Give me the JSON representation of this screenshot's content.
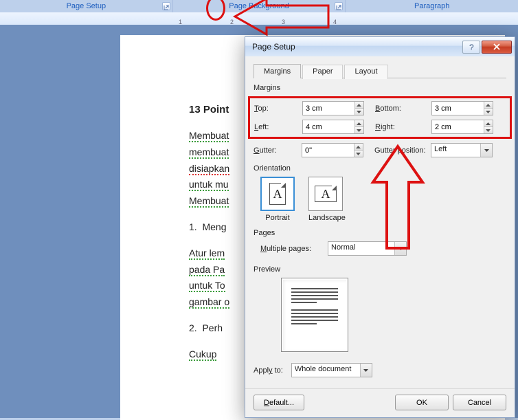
{
  "ribbon": {
    "groups": [
      "Page Setup",
      "Page Background",
      "Paragraph"
    ]
  },
  "ruler": {
    "marks": [
      "1",
      "2",
      "3",
      "4"
    ]
  },
  "document": {
    "title": "13 Point",
    "para1_a": "Membuat",
    "para1_b": "membuat",
    "para1_c": "disiapkan",
    "para1_d": "untuk mu",
    "para1_e": "Membuat",
    "list1": "Meng",
    "para2_a": "Atur lem",
    "para2_b": "pada Pa",
    "para2_c": "untuk To",
    "para2_d": "gambar o",
    "list2": "Perh",
    "para3": "Cukup"
  },
  "dialog": {
    "title": "Page Setup",
    "tabs": {
      "margins": "Margins",
      "paper": "Paper",
      "layout": "Layout"
    },
    "sections": {
      "margins_label": "Margins",
      "orientation_label": "Orientation",
      "pages_label": "Pages",
      "preview_label": "Preview"
    },
    "margins": {
      "top_label": "Top:",
      "top_value": "3 cm",
      "bottom_label": "Bottom:",
      "bottom_value": "3 cm",
      "left_label": "Left:",
      "left_value": "4 cm",
      "right_label": "Right:",
      "right_value": "2 cm",
      "gutter_label": "Gutter:",
      "gutter_value": "0\"",
      "gutter_pos_label": "Gutter position:",
      "gutter_pos_value": "Left"
    },
    "orientation": {
      "portrait": "Portrait",
      "landscape": "Landscape"
    },
    "pages": {
      "multiple_label": "Multiple pages:",
      "multiple_value": "Normal"
    },
    "apply": {
      "label": "Apply to:",
      "value": "Whole document"
    },
    "buttons": {
      "default": "Default...",
      "ok": "OK",
      "cancel": "Cancel"
    }
  }
}
